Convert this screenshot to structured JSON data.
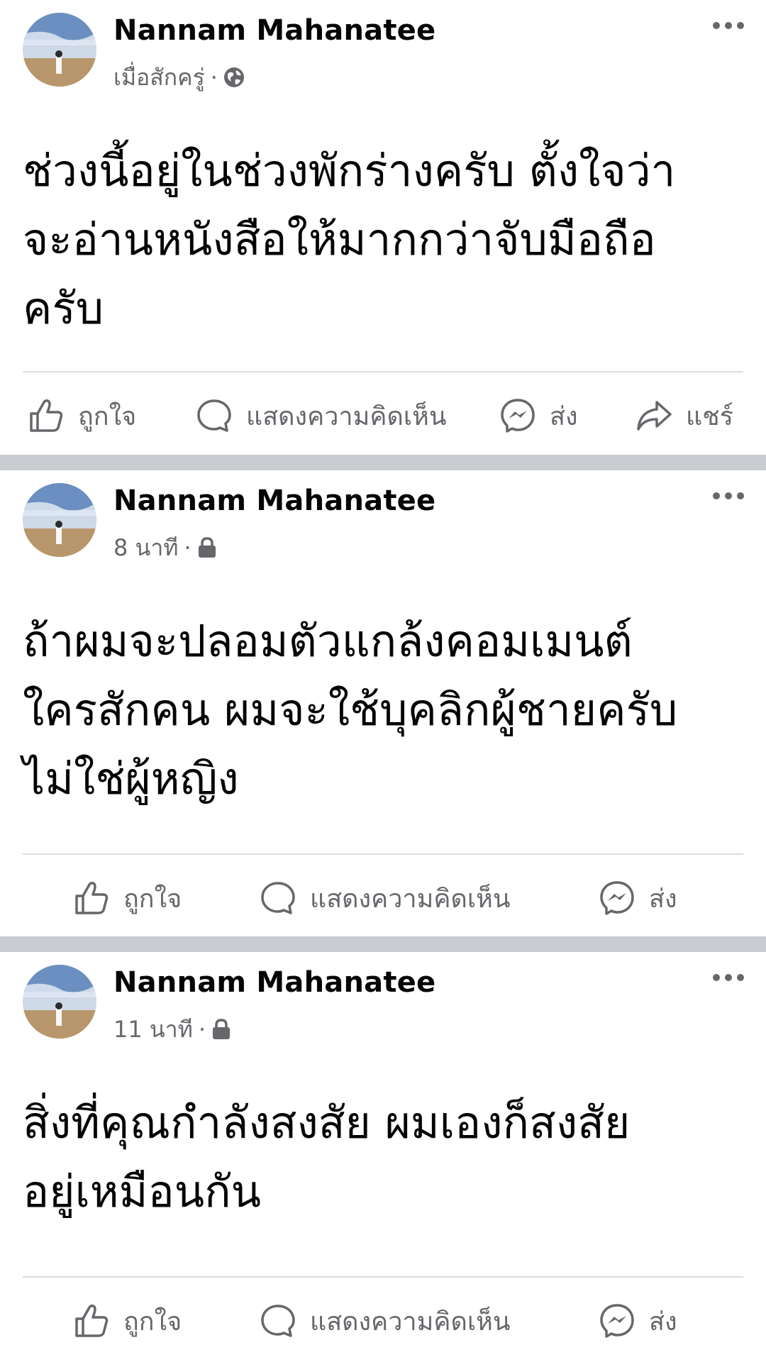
{
  "posts": [
    {
      "author": "Nannam Mahanatee",
      "time": "เมื่อสักครู่",
      "separator": "·",
      "audience_icon": "globe-icon",
      "text": "ช่วงนี้อยู่ในช่วงพักร่างครับ ตั้งใจว่า\nจะอ่านหนังสือให้มากกว่าจับมือถือ\nครับ",
      "actions": {
        "like": "ถูกใจ",
        "comment": "แสดงความคิดเห็น",
        "send": "ส่ง",
        "share": "แชร์"
      }
    },
    {
      "author": "Nannam Mahanatee",
      "time": "8 นาที",
      "separator": "·",
      "audience_icon": "lock-icon",
      "text": "ถ้าผมจะปลอมตัวแกล้งคอมเมนต์\nใครสักคน ผมจะใช้บุคลิกผู้ชายครับ\nไม่ใช่ผู้หญิง",
      "actions": {
        "like": "ถูกใจ",
        "comment": "แสดงความคิดเห็น",
        "send": "ส่ง"
      }
    },
    {
      "author": "Nannam Mahanatee",
      "time": "11 นาที",
      "separator": "·",
      "audience_icon": "lock-icon",
      "text": "สิ่งที่คุณกำลังสงสัย ผมเองก็สงสัย\nอยู่เหมือนกัน",
      "actions": {
        "like": "ถูกใจ",
        "comment": "แสดงความคิดเห็น",
        "send": "ส่ง"
      }
    }
  ],
  "colors": {
    "text_primary": "#050505",
    "text_secondary": "#65676b",
    "separator": "#c9ccd1",
    "divider": "#dadde1"
  }
}
